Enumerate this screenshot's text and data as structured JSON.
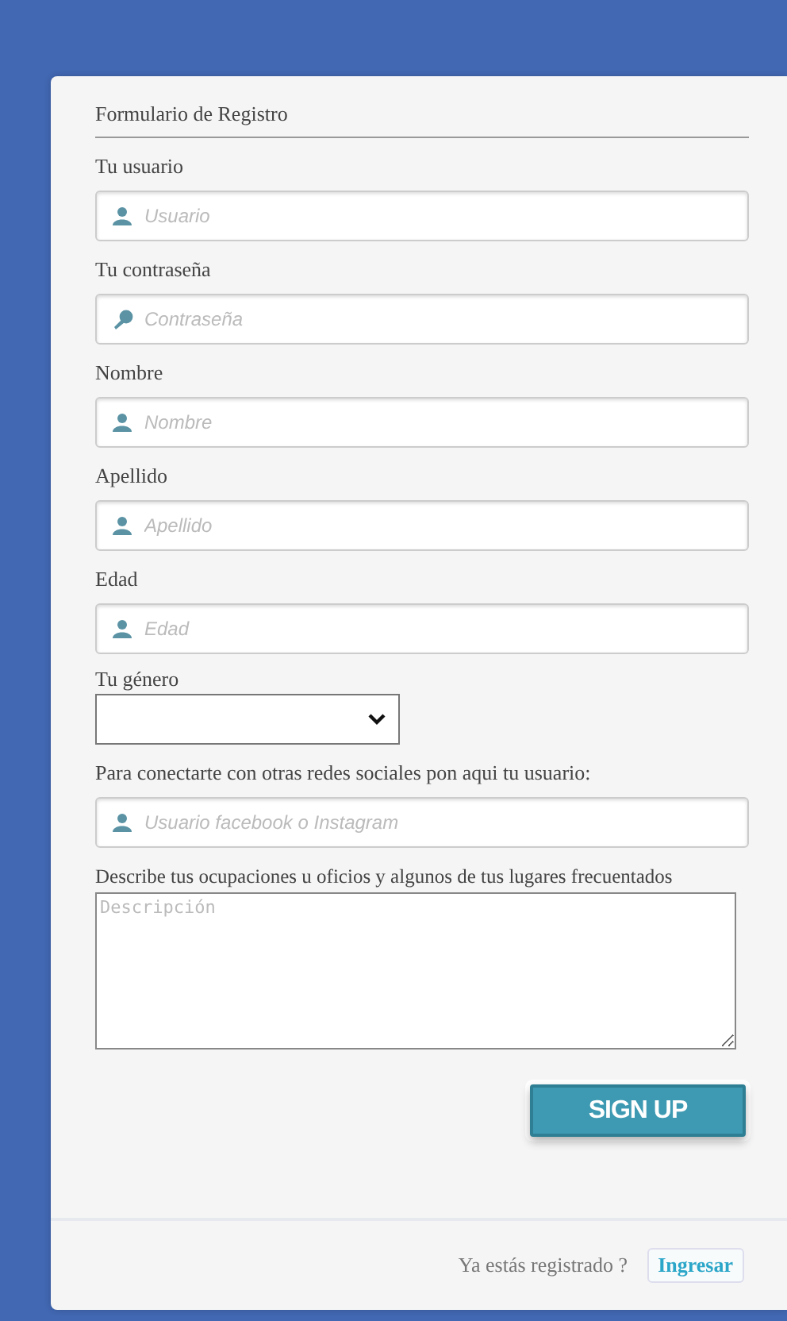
{
  "form": {
    "title": "Formulario de Registro",
    "fields": [
      {
        "kind": "text",
        "label": "Tu usuario",
        "placeholder": "Usuario"
      },
      {
        "kind": "password",
        "label": "Tu contraseña",
        "placeholder": "Contraseña"
      },
      {
        "kind": "text",
        "label": "Nombre",
        "placeholder": "Nombre"
      },
      {
        "kind": "text",
        "label": "Apellido",
        "placeholder": "Apellido"
      },
      {
        "kind": "text",
        "label": "Edad",
        "placeholder": "Edad"
      },
      {
        "kind": "select",
        "label": "Tu género"
      },
      {
        "kind": "text",
        "label": "Para conectarte con otras redes sociales pon aqui tu usuario:",
        "placeholder": "Usuario facebook o Instagram"
      },
      {
        "kind": "textarea",
        "label": "Describe tus ocupaciones u oficios y algunos de tus lugares frecuentados",
        "placeholder": "Descripción"
      }
    ],
    "submit": "SIGN UP"
  },
  "footer": {
    "text": "Ya estás registrado ?",
    "link": "Ingresar"
  }
}
